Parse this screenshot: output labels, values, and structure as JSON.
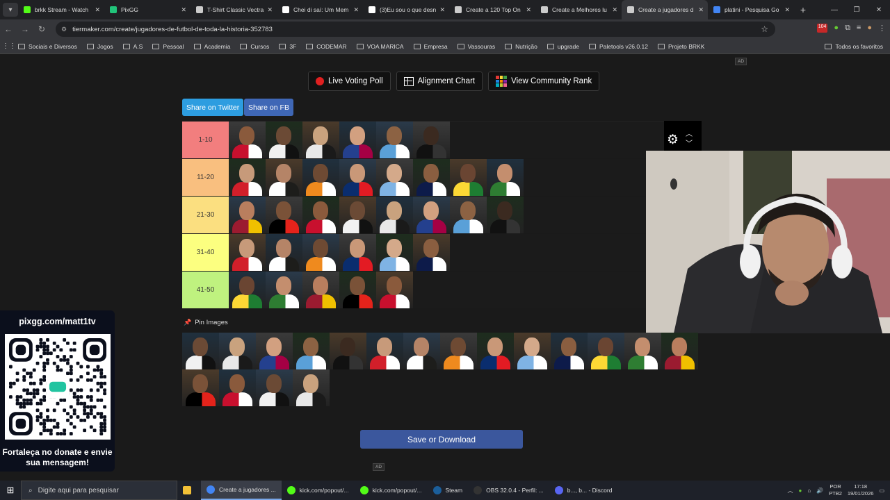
{
  "browser": {
    "tabs": [
      {
        "title": "brkk Stream - Watch",
        "icon": "kick-icon",
        "color": "#53fc18"
      },
      {
        "title": "PixGG",
        "icon": "pixgg-icon",
        "color": "#21c47a"
      },
      {
        "title": "T-Shirt Classic Vectra",
        "icon": "globe-icon",
        "color": "#cccccc"
      },
      {
        "title": "Chei di saí: Um Mem",
        "icon": "tiktok-icon",
        "color": "#ffffff"
      },
      {
        "title": "(3)Eu sou o que desn",
        "icon": "tiktok-icon",
        "color": "#ffffff"
      },
      {
        "title": "Create a 120 Top On",
        "icon": "tiermaker-icon",
        "color": "#cccccc"
      },
      {
        "title": "Create a Melhores lu",
        "icon": "tiermaker-icon",
        "color": "#cccccc"
      },
      {
        "title": "Create a jugadores d",
        "icon": "tiermaker-icon",
        "color": "#cccccc",
        "active": true
      },
      {
        "title": "platini - Pesquisa Go",
        "icon": "google-icon",
        "color": "#4285f4"
      }
    ],
    "url": "tiermaker.com/create/jugadores-de-futbol-de-toda-la-historia-352783",
    "ext_badge": "104",
    "bookmarks": [
      "Sociais e Diversos",
      "Jogos",
      "A.S",
      "Pessoal",
      "Academia",
      "Cursos",
      "3F",
      "CODEMAR",
      "VOA MARICA",
      "Empresa",
      "Vassouras",
      "Nutrição",
      "upgrade",
      "Paletools v26.0.12",
      "Projeto BRKK"
    ],
    "bookmarks_right": "Todos os favoritos"
  },
  "page": {
    "ad_label": "AD",
    "buttons": {
      "live": "Live Voting Poll",
      "alignment": "Alignment Chart",
      "community": "View Community Rank"
    },
    "share_twitter": "Share on Twitter",
    "share_fb": "Share on FB",
    "tiers": [
      {
        "label": "1-10",
        "color": "#f27e7e",
        "count": 6
      },
      {
        "label": "11-20",
        "color": "#f9bf7f",
        "count": 8
      },
      {
        "label": "21-30",
        "color": "#fbdf80",
        "count": 8
      },
      {
        "label": "31-40",
        "color": "#fcff80",
        "count": 6
      },
      {
        "label": "41-50",
        "color": "#bff27f",
        "count": 5
      }
    ],
    "pin_label": "Pin Images",
    "pool_rows": [
      14,
      4
    ],
    "save": "Save or Download"
  },
  "overlay": {
    "qr_title": "pixgg.com/matt1tv",
    "qr_bottom": "Fortaleça no donate e envie sua mensagem!"
  },
  "taskbar": {
    "search": "Digite aqui para pesquisar",
    "apps": [
      {
        "label": "Create a jugadores ...",
        "icon": "chrome-icon",
        "color": "#4285f4",
        "active": true
      },
      {
        "label": "kick.com/popout/...",
        "icon": "kick-icon",
        "color": "#53fc18"
      },
      {
        "label": "kick.com/popout/...",
        "icon": "kick-icon",
        "color": "#53fc18"
      },
      {
        "label": "Steam",
        "icon": "steam-icon",
        "color": "#1b5e9a"
      },
      {
        "label": "OBS 32.0.4 - Perfil: ...",
        "icon": "obs-icon",
        "color": "#333333"
      },
      {
        "label": "b..., b... - Discord",
        "icon": "discord-icon",
        "color": "#5865f2"
      }
    ],
    "lang": "POR",
    "lang2": "PTB2",
    "time": "17:18",
    "date": "19/01/2026"
  }
}
